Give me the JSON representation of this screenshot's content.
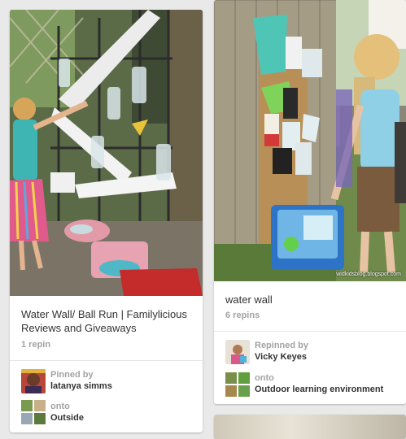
{
  "pins": [
    {
      "title": "Water Wall/ Ball Run | Familylicious Reviews and Giveaways",
      "repin_count": "1 repin",
      "pinner_label": "Pinned by",
      "pinner_name": "latanya simms",
      "board_label": "onto",
      "board_name": "Outside"
    },
    {
      "title": "water wall",
      "repin_count": "6 repins",
      "pinner_label": "Repinned by",
      "pinner_name": "Vicky Keyes",
      "board_label": "onto",
      "board_name": "Outdoor learning environment",
      "photo_watermark": "widkidsblog.blogspot.com"
    }
  ]
}
